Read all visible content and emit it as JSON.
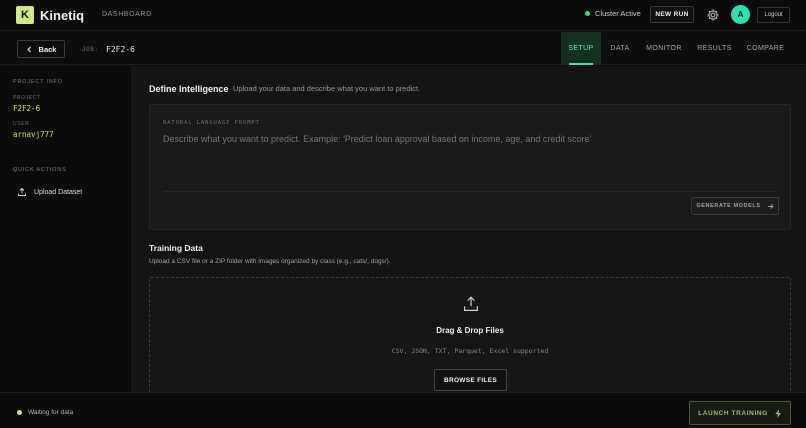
{
  "app": {
    "logo_letter": "K",
    "name": "Kinetiq",
    "nav_dashboard": "DASHBOARD"
  },
  "topbar": {
    "cluster_status": "Cluster Active",
    "new_run_label": "NEW RUN",
    "avatar_initial": "A",
    "logout_label": "Logout",
    "accent_color": "#2ee0b4"
  },
  "subbar": {
    "back_label": "Back",
    "job_label": "JOB:",
    "job_id": "F2F2-6",
    "tabs": [
      {
        "label": "SETUP",
        "active": true
      },
      {
        "label": "DATA",
        "active": false
      },
      {
        "label": "MONITOR",
        "active": false
      },
      {
        "label": "RESULTS",
        "active": false
      },
      {
        "label": "COMPARE",
        "active": false
      }
    ]
  },
  "sidebar": {
    "project_info_heading": "PROJECT INFO",
    "project_label": "PROJECT",
    "project_value": "F2F2-6",
    "user_label": "USER",
    "user_value": "arnavj777",
    "quick_actions_heading": "QUICK ACTIONS",
    "upload_dataset_label": "Upload Dataset"
  },
  "define": {
    "title": "Define Intelligence",
    "subtitle": "Upload your data and describe what you want to predict.",
    "prompt_label": "NATURAL LANGUAGE PROMPT",
    "prompt_value": "",
    "prompt_placeholder": "Describe what you want to predict. Example: 'Predict loan approval based on income, age, and credit score'",
    "generate_label": "GENERATE MODELS"
  },
  "training": {
    "title": "Training Data",
    "subtitle": "Upload a CSV file or a ZIP folder with images organized by class (e.g., cats/, dogs/).",
    "drop_title": "Drag & Drop Files",
    "drop_formats": "CSV, JSON, TXT, Parquet, Excel supported",
    "browse_label": "BROWSE FILES"
  },
  "footer": {
    "status_text": "Waiting for data",
    "launch_label": "LAUNCH TRAINING"
  }
}
